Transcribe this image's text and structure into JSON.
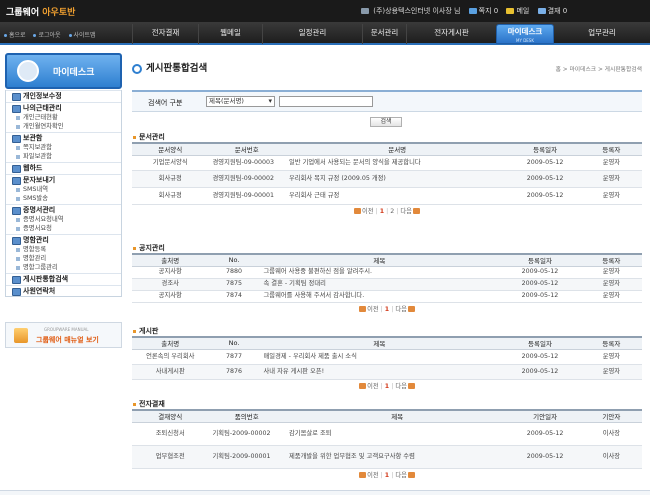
{
  "header": {
    "logo_main": "그룹웨어",
    "logo_accent": "아우토반",
    "user_text": "(주)상용텍스인터넷 이사장 님",
    "counters": [
      {
        "label": "쪽지 0",
        "icon": "note-icon",
        "color": "#5aa0e0"
      },
      {
        "label": "메일",
        "icon": "mail-icon",
        "color": "#e8c030"
      },
      {
        "label": "결재 0",
        "icon": "approval-icon",
        "color": "#7ab0e8"
      }
    ]
  },
  "nav": {
    "util_links": [
      "홈으로",
      "로그아웃",
      "사이트맵"
    ],
    "tabs": [
      {
        "label": "전자결재"
      },
      {
        "label": "웹메일"
      },
      {
        "label": "일정관리"
      },
      {
        "label": "문서관리"
      },
      {
        "label": "전자게시판"
      },
      {
        "label": "마이데스크",
        "sub": "MY DESK",
        "active": true
      },
      {
        "label": "업무관리"
      }
    ]
  },
  "sidebar": {
    "title": "마이데스크",
    "blocks": [
      {
        "title": "개인정보수정",
        "items": []
      },
      {
        "title": "나의근태관리",
        "items": [
          "개인근태현황",
          "개인월연차확인"
        ]
      },
      {
        "title": "보관함",
        "items": [
          "쪽지보관함",
          "파일보관함"
        ]
      },
      {
        "title": "웹하드",
        "items": []
      },
      {
        "title": "문자보내기",
        "items": [
          "SMS내역",
          "SMS발송"
        ]
      },
      {
        "title": "증명서관리",
        "items": [
          "증명서요청내역",
          "증명서요청"
        ]
      },
      {
        "title": "명함관리",
        "items": [
          "명함등록",
          "명함관리",
          "명함그룹관리"
        ]
      },
      {
        "title": "게시판통합검색",
        "items": []
      },
      {
        "title": "사원연락처",
        "items": []
      }
    ],
    "manual_small": "GROUPWARE MANUAL",
    "manual_label": "그룹웨어 매뉴얼 보기"
  },
  "main": {
    "title": "게시판통합검색",
    "breadcrumb": "홈 > 마이데스크 > 게시판통합검색",
    "search": {
      "label": "검색어 구분",
      "selected": "제목(문서명)",
      "value": "",
      "button": "검색"
    },
    "sections": [
      {
        "title": "문서관리",
        "columns": [
          "문서양식",
          "문서번호",
          "문서명",
          "등록일자",
          "등록자"
        ],
        "rows": [
          [
            "기업문서양식",
            "경영지원팀-09-00003",
            "일반 기업에서 사용되는 문서의 양식을 제공합니다",
            "2009-05-12",
            "운영자"
          ],
          [
            "회사규정",
            "경영지원팀-09-00002",
            "우리회사 복지 규정 (2009.05 개정)",
            "2009-05-12",
            "운영자"
          ],
          [
            "회사규정",
            "경영지원팀-09-00001",
            "우리회사 근태 규정",
            "2009-05-12",
            "운영자"
          ]
        ],
        "pager": {
          "prev": "이전",
          "pages": [
            "1",
            "2"
          ],
          "current": "1",
          "next": "다음"
        }
      },
      {
        "title": "공지관리",
        "columns": [
          "출처명",
          "No.",
          "제목",
          "등록일자",
          "등록자"
        ],
        "rows": [
          [
            "공지사항",
            "7880",
            "그룹웨어 사용중 불편하신 점을 알려주시.",
            "2009-05-12",
            "운영자"
          ],
          [
            "경조사",
            "7875",
            "속 결혼 - 기획팀 정대리",
            "2009-05-12",
            "운영자"
          ],
          [
            "공지사항",
            "7874",
            "그룹웨어를 사용해 주셔서 감사합니다.",
            "2009-05-12",
            "운영자"
          ]
        ],
        "pager": {
          "prev": "이전",
          "pages": [
            "1"
          ],
          "current": "1",
          "next": "다음"
        }
      },
      {
        "title": "게시판",
        "columns": [
          "출처명",
          "No.",
          "제목",
          "등록일자",
          "등록자"
        ],
        "rows": [
          [
            "언론속의 우리회사",
            "7877",
            "매일경제 - 우리회사 제품 출시 소식",
            "2009-05-12",
            "운영자"
          ],
          [
            "사내게시판",
            "7876",
            "사내 자유 게시판 오픈!",
            "2009-05-12",
            "운영자"
          ]
        ],
        "pager": {
          "prev": "이전",
          "pages": [
            "1"
          ],
          "current": "1",
          "next": "다음"
        }
      },
      {
        "title": "전자결재",
        "columns": [
          "결재양식",
          "품의번호",
          "제목",
          "기안일자",
          "기안자"
        ],
        "rows": [
          [
            "조퇴신청서",
            "기획팀-2009-00002",
            "감기몸살로 조퇴",
            "2009-05-12",
            "이사장"
          ],
          [
            "업무협조전",
            "기획팀-2009-00001",
            "제품개발을 위한 업무협조 및 고객요구사항 수렴",
            "2009-05-12",
            "이사장"
          ]
        ],
        "pager": {
          "prev": "이전",
          "pages": [
            "1"
          ],
          "current": "1",
          "next": "다음"
        }
      }
    ]
  }
}
